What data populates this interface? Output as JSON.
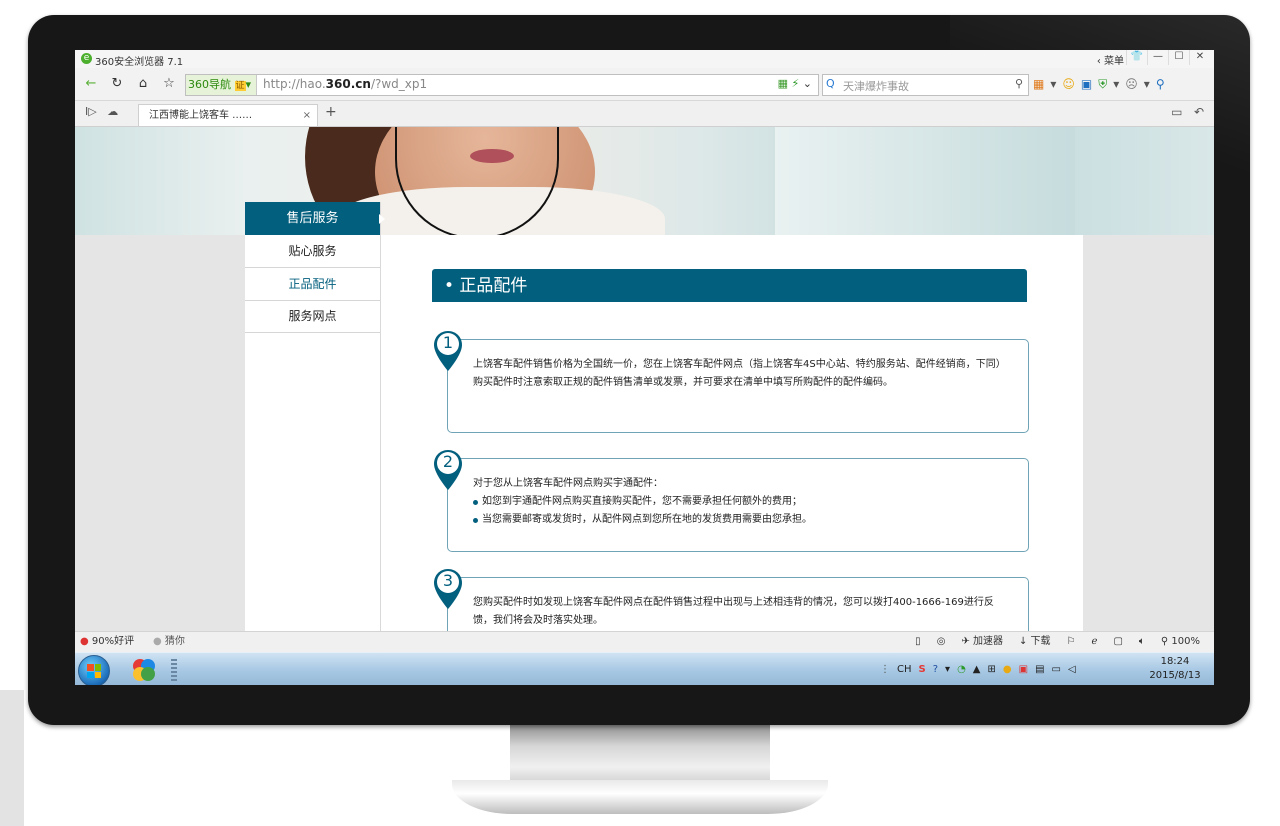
{
  "browser": {
    "title": "360安全浏览器 7.1",
    "menu_label": "菜单",
    "nav_badge": "360导航",
    "cert_badge": "证",
    "url_prefix": "http://hao.",
    "url_domain": "360.cn",
    "url_suffix": "/?wd_xp1",
    "search_placeholder": "天津爆炸事故",
    "tab_title": "江西博能上饶客车 ……",
    "tab_close": "×",
    "tab_add": "+"
  },
  "sidebar": {
    "heading": "售后服务",
    "items": [
      {
        "label": "贴心服务"
      },
      {
        "label": "正品配件"
      },
      {
        "label": "服务网点"
      }
    ]
  },
  "content": {
    "section_title": "• 正品配件",
    "cards": [
      {
        "number": "1",
        "text": "上饶客车配件销售价格为全国统一价，您在上饶客车配件网点（指上饶客车4S中心站、特约服务站、配件经销商，下同）购买配件时注意索取正规的配件销售清单或发票，并可要求在清单中填写所购配件的配件编码。"
      },
      {
        "number": "2",
        "intro": "对于您从上饶客车配件网点购买宇通配件：",
        "bullets": [
          "如您到宇通配件网点购买直接购买配件，您不需要承担任何额外的费用；",
          "当您需要邮寄或发货时，从配件网点到您所在地的发货费用需要由您承担。"
        ]
      },
      {
        "number": "3",
        "text": "您购买配件时如发现上饶客车配件网点在配件销售过程中出现与上述相违背的情况，您可以拨打400-1666-169进行反馈，我们将会及时落实处理。"
      }
    ]
  },
  "statusbar": {
    "rating": "90%好评",
    "guess": "猜你",
    "accelerator": "加速器",
    "download": "下载",
    "zoom": "100%"
  },
  "taskbar": {
    "ime": "CH",
    "time": "18:24",
    "date": "2015/8/13"
  },
  "colors": {
    "accent": "#035f7e",
    "card_border": "#6fa3b5"
  }
}
